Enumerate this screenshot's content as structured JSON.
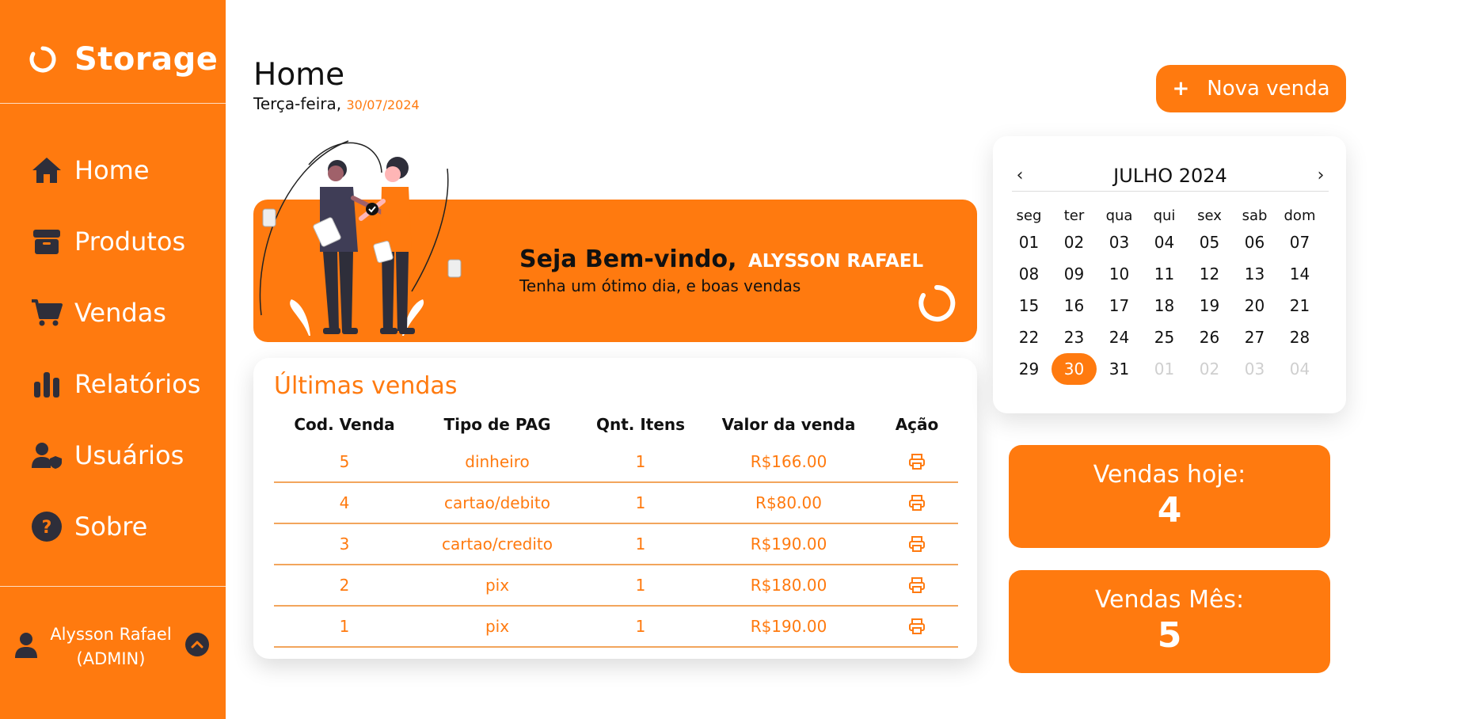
{
  "sidebar": {
    "logo_text": "Storage",
    "items": [
      {
        "label": "Home",
        "icon": "home-icon"
      },
      {
        "label": "Produtos",
        "icon": "box-icon"
      },
      {
        "label": "Vendas",
        "icon": "cart-icon"
      },
      {
        "label": "Relatórios",
        "icon": "bar-chart-icon"
      },
      {
        "label": "Usuários",
        "icon": "user-shield-icon"
      },
      {
        "label": "Sobre",
        "icon": "question-icon"
      }
    ],
    "user": {
      "name": "Alysson Rafael",
      "role": "(ADMIN)"
    }
  },
  "header": {
    "title": "Home",
    "weekday": "Terça-feira,",
    "date": "30/07/2024",
    "new_sale_label": "Nova venda"
  },
  "welcome": {
    "greeting": "Seja Bem-vindo,",
    "name": "ALYSSON RAFAEL",
    "subtitle": "Tenha um ótimo dia, e boas vendas"
  },
  "sales": {
    "title": "Últimas vendas",
    "columns": [
      "Cod. Venda",
      "Tipo de PAG",
      "Qnt. Itens",
      "Valor da venda",
      "Ação"
    ],
    "rows": [
      {
        "cod": "5",
        "tipo": "dinheiro",
        "qnt": "1",
        "valor": "R$166.00"
      },
      {
        "cod": "4",
        "tipo": "cartao/debito",
        "qnt": "1",
        "valor": "R$80.00"
      },
      {
        "cod": "3",
        "tipo": "cartao/credito",
        "qnt": "1",
        "valor": "R$190.00"
      },
      {
        "cod": "2",
        "tipo": "pix",
        "qnt": "1",
        "valor": "R$180.00"
      },
      {
        "cod": "1",
        "tipo": "pix",
        "qnt": "1",
        "valor": "R$190.00"
      }
    ]
  },
  "calendar": {
    "prev": "‹",
    "next": "›",
    "title": "JULHO 2024",
    "weekdays": [
      "seg",
      "ter",
      "qua",
      "qui",
      "sex",
      "sab",
      "dom"
    ],
    "weeks": [
      [
        "01",
        "02",
        "03",
        "04",
        "05",
        "06",
        "07"
      ],
      [
        "08",
        "09",
        "10",
        "11",
        "12",
        "13",
        "14"
      ],
      [
        "15",
        "16",
        "17",
        "18",
        "19",
        "20",
        "21"
      ],
      [
        "22",
        "23",
        "24",
        "25",
        "26",
        "27",
        "28"
      ],
      [
        "29",
        "30",
        "31",
        "01",
        "02",
        "03",
        "04"
      ]
    ],
    "selected": "30",
    "muted_from_week5_index": 3
  },
  "stats": {
    "today_label": "Vendas hoje:",
    "today_value": "4",
    "month_label": "Vendas Mês:",
    "month_value": "5"
  },
  "colors": {
    "accent": "#ff7a0f",
    "dark": "#2e2e3a"
  }
}
